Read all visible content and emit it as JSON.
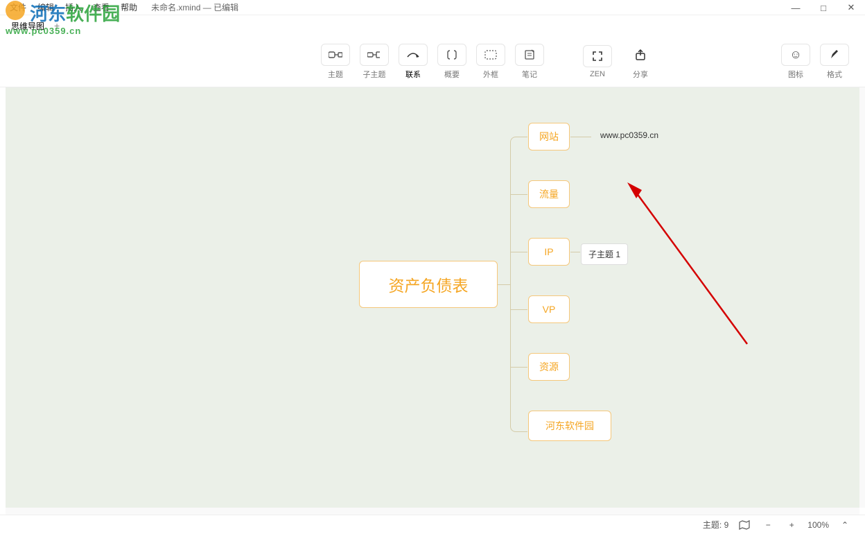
{
  "menu": {
    "file": "文件",
    "edit": "编辑",
    "insert": "插入",
    "view": "查看",
    "help": "帮助",
    "title": "未命名.xmind — 已编辑"
  },
  "window": {
    "min": "—",
    "max": "□",
    "close": "✕"
  },
  "tabs": {
    "tab1": "思维导图",
    "plus": "+"
  },
  "toolbar": {
    "topic": "主题",
    "subtopic": "子主题",
    "relationship": "联系",
    "summary": "概要",
    "boundary": "外框",
    "note": "笔记",
    "zen": "ZEN",
    "share": "分享",
    "icon": "图标",
    "format": "格式"
  },
  "mindmap": {
    "central": "资产负债表",
    "children": {
      "c1": "网站",
      "c2": "流量",
      "c3": "IP",
      "c4": "VP",
      "c5": "资源",
      "c6": "河东软件园"
    },
    "sub1": "www.pc0359.cn",
    "sub3": "子主题 1"
  },
  "status": {
    "topics_label": "主题:",
    "topic_count": "9",
    "zoom": "100%"
  },
  "watermark": {
    "text_a": "河东",
    "text_b": "软件园",
    "url": "www.pc0359.cn"
  }
}
